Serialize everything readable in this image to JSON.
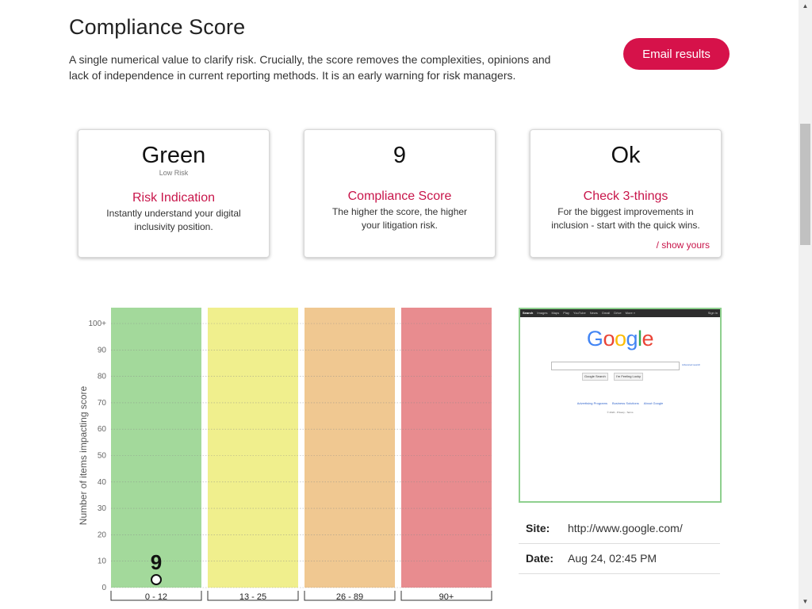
{
  "header": {
    "title": "Compliance Score",
    "intro": "A single numerical value to clarify risk. Crucially, the score removes the complexities, opinions and lack of independence in current reporting methods. It is an early warning for risk managers.",
    "email_label": "Email results"
  },
  "cards": [
    {
      "value": "Green",
      "sub": "Low Risk",
      "title": "Risk Indication",
      "desc": "Instantly understand your digital inclusivity position."
    },
    {
      "value": "9",
      "title": "Compliance Score",
      "desc": "The higher the score, the higher your litigation risk."
    },
    {
      "value": "Ok",
      "title": "Check 3-things",
      "desc": "For the biggest improvements in inclusion - start with the quick wins.",
      "link": "/ show yours"
    }
  ],
  "chart_data": {
    "type": "bar",
    "ylabel": "Number of items impacting score",
    "ylim": [
      0,
      100
    ],
    "yticks": [
      "0",
      "10",
      "20",
      "30",
      "40",
      "50",
      "60",
      "70",
      "80",
      "90",
      "100+"
    ],
    "bands": [
      {
        "label": "0 - 12",
        "color": "#a3d99b"
      },
      {
        "label": "13 - 25",
        "color": "#f0ef8d"
      },
      {
        "label": "26 - 89",
        "color": "#f0c891"
      },
      {
        "label": "90+",
        "color": "#e88c8f"
      }
    ],
    "marker": {
      "score": "9",
      "band_index": 0,
      "items": 3
    }
  },
  "screenshot": {
    "nav": [
      "Search",
      "Images",
      "Maps",
      "Play",
      "YouTube",
      "News",
      "Gmail",
      "Drive",
      "More »"
    ],
    "signin": "Sign in",
    "logo_letters": [
      "G",
      "o",
      "o",
      "g",
      "l",
      "e"
    ],
    "logo_colors": [
      "#4285f4",
      "#ea4335",
      "#fbbc05",
      "#4285f4",
      "#34a853",
      "#ea4335"
    ],
    "advanced": "Advanced search",
    "btn_search": "Google Search",
    "btn_lucky": "I'm Feeling Lucky",
    "links": [
      "Advertising Programs",
      "Business Solutions",
      "About Google"
    ],
    "copyright": "© 2022 - Privacy - Terms"
  },
  "details": {
    "site_label": "Site:",
    "site_value": "http://www.google.com/",
    "date_label": "Date:",
    "date_value": "Aug 24, 02:45 PM"
  },
  "scrollbar": {
    "up_icon": "▲",
    "down_icon": "▼"
  }
}
